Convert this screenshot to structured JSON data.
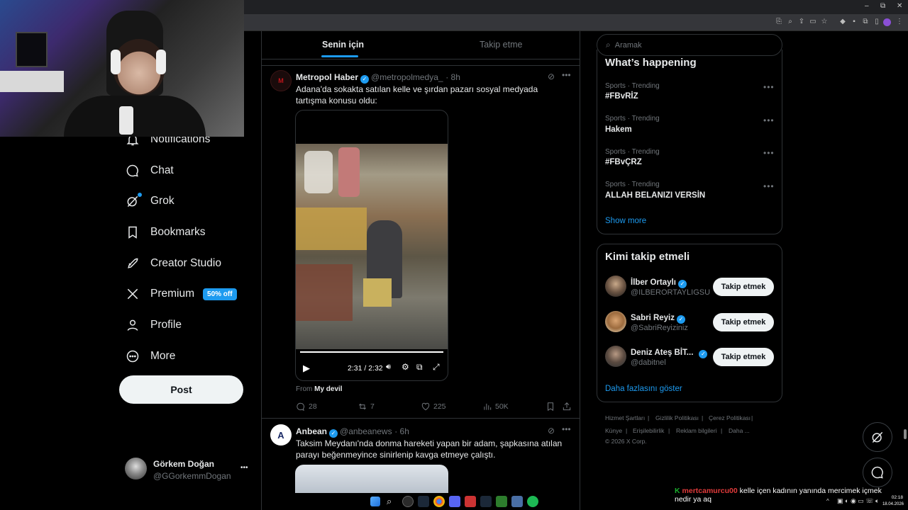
{
  "browser": {
    "window_controls": [
      "–",
      "⧉",
      "✕"
    ]
  },
  "sidebar": {
    "items": [
      {
        "label": "Notifications",
        "icon": "bell-icon"
      },
      {
        "label": "Chat",
        "icon": "chat-bubble-icon"
      },
      {
        "label": "Grok",
        "icon": "grok-icon"
      },
      {
        "label": "Bookmarks",
        "icon": "bookmark-icon"
      },
      {
        "label": "Creator Studio",
        "icon": "rocket-icon"
      },
      {
        "label": "Premium",
        "icon": "x-logo-icon",
        "badge": "50% off"
      },
      {
        "label": "Profile",
        "icon": "person-icon"
      },
      {
        "label": "More",
        "icon": "more-circle-icon"
      }
    ],
    "post_label": "Post",
    "account": {
      "name": "Görkem Doğan",
      "handle": "@GGorkemmDogan",
      "menu": "•••"
    }
  },
  "feed": {
    "tabs": [
      "Senin için",
      "Takip etme"
    ],
    "tweets": [
      {
        "name": "Metropol Haber",
        "handle": "@metropolmedya_",
        "time": "· 8h",
        "text": "Adana'da sokakta satılan kelle ve şırdan pazarı sosyal medyada tartışma konusu oldu:",
        "video_time": "2:31 / 2:32",
        "from_label": "From",
        "from_source": "My devil",
        "replies": "28",
        "reposts": "7",
        "likes": "225",
        "views": "50K",
        "avatar_letter": "M"
      },
      {
        "name": "Anbean",
        "handle": "@anbeanews",
        "time": "· 6h",
        "text": "Taksim Meydanı'nda donma hareketi yapan bir adam, şapkasına atılan parayı beğenmeyince sinirlenip kavga etmeye çalıştı."
      }
    ]
  },
  "right": {
    "search_placeholder": "Aramak",
    "trending_title": "What’s happening",
    "trends": [
      {
        "meta": "Sports · Trending",
        "name": "#FBvRİZ"
      },
      {
        "meta": "Sports · Trending",
        "name": "Hakem"
      },
      {
        "meta": "Sports · Trending",
        "name": "#FBvÇRZ"
      },
      {
        "meta": "Sports · Trending",
        "name": "ALLAH BELANIZI VERSİN"
      }
    ],
    "show_more": "Show more",
    "who_to_follow_title": "Kimi takip etmeli",
    "follow": [
      {
        "name": "İlber Ortaylı",
        "handle": "@ILBERORTAYLIGSU",
        "button": "Takip etmek"
      },
      {
        "name": "Sabri Reyiz",
        "handle": "@SabriReyiziniz",
        "button": "Takip etmek"
      },
      {
        "name": "Deniz Ateş BİT...",
        "handle": "@dabitnel",
        "button": "Takip etmek"
      }
    ],
    "show_more_follow": "Daha fazlasını göster",
    "footer_links": [
      "Hizmet Şartları",
      "Gizlilik Politikası",
      "Çerez Politikası",
      "Künye",
      "Erişilebilirlik",
      "Reklam bilgileri",
      "Daha ..."
    ],
    "copyright": "© 2026 X Corp."
  },
  "chat_overlay": {
    "user": "mertcamurcu00",
    "message": "kelle içen kadının yanında mercimek içmek nedir ya aq"
  },
  "taskbar": {
    "time": "02:18",
    "date": "18.04.2026"
  }
}
